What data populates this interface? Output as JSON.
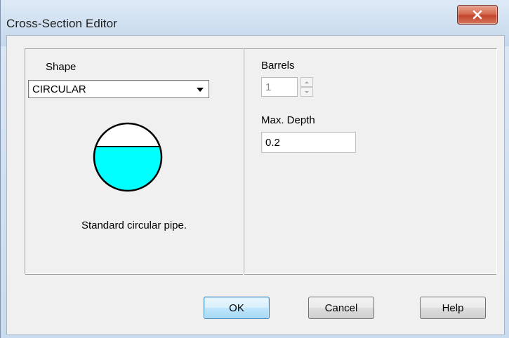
{
  "window": {
    "title": "Cross-Section Editor",
    "close_icon": "close-icon"
  },
  "shape": {
    "label": "Shape",
    "selected": "CIRCULAR",
    "description": "Standard circular pipe.",
    "preview_colors": {
      "fill": "#00ffff",
      "stroke": "#000000"
    }
  },
  "barrels": {
    "label": "Barrels",
    "value": "1"
  },
  "max_depth": {
    "label": "Max. Depth",
    "value": "0.2"
  },
  "buttons": {
    "ok": "OK",
    "cancel": "Cancel",
    "help": "Help"
  }
}
